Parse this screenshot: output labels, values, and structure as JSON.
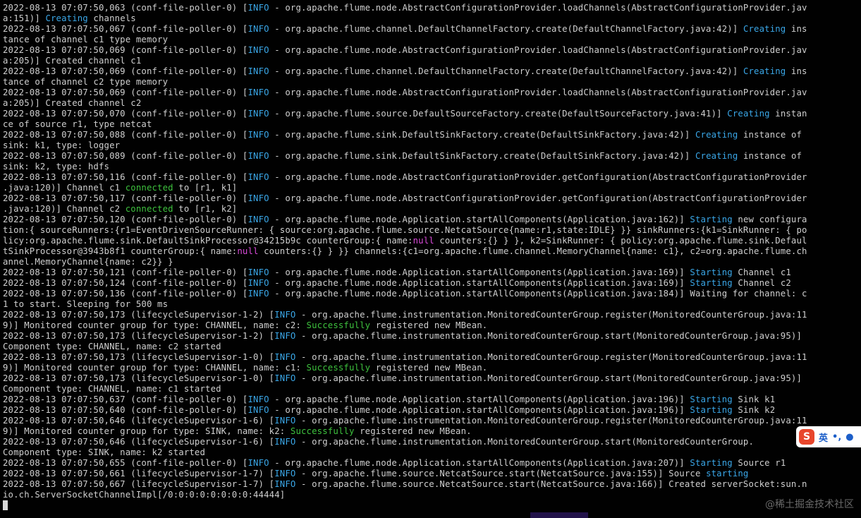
{
  "terminal": {
    "lines": [
      [
        {
          "t": "2022-08-13 07:07:50,063 (conf-file-poller-0) ["
        },
        {
          "t": "INFO",
          "c": "blue"
        },
        {
          "t": " - org.apache.flume.node.AbstractConfigurationProvider.loadChannels(AbstractConfigurationProvider.jav"
        }
      ],
      [
        {
          "t": "a:151)] "
        },
        {
          "t": "Creating",
          "c": "blue"
        },
        {
          "t": " channels"
        }
      ],
      [
        {
          "t": "2022-08-13 07:07:50,067 (conf-file-poller-0) ["
        },
        {
          "t": "INFO",
          "c": "blue"
        },
        {
          "t": " - org.apache.flume.channel.DefaultChannelFactory.create(DefaultChannelFactory.java:42)] "
        },
        {
          "t": "Creating",
          "c": "blue"
        },
        {
          "t": " ins"
        }
      ],
      [
        {
          "t": "tance of channel c1 type memory"
        }
      ],
      [
        {
          "t": "2022-08-13 07:07:50,069 (conf-file-poller-0) ["
        },
        {
          "t": "INFO",
          "c": "blue"
        },
        {
          "t": " - org.apache.flume.node.AbstractConfigurationProvider.loadChannels(AbstractConfigurationProvider.jav"
        }
      ],
      [
        {
          "t": "a:205)] Created channel c1"
        }
      ],
      [
        {
          "t": "2022-08-13 07:07:50,069 (conf-file-poller-0) ["
        },
        {
          "t": "INFO",
          "c": "blue"
        },
        {
          "t": " - org.apache.flume.channel.DefaultChannelFactory.create(DefaultChannelFactory.java:42)] "
        },
        {
          "t": "Creating",
          "c": "blue"
        },
        {
          "t": " ins"
        }
      ],
      [
        {
          "t": "tance of channel c2 type memory"
        }
      ],
      [
        {
          "t": "2022-08-13 07:07:50,069 (conf-file-poller-0) ["
        },
        {
          "t": "INFO",
          "c": "blue"
        },
        {
          "t": " - org.apache.flume.node.AbstractConfigurationProvider.loadChannels(AbstractConfigurationProvider.jav"
        }
      ],
      [
        {
          "t": "a:205)] Created channel c2"
        }
      ],
      [
        {
          "t": "2022-08-13 07:07:50,070 (conf-file-poller-0) ["
        },
        {
          "t": "INFO",
          "c": "blue"
        },
        {
          "t": " - org.apache.flume.source.DefaultSourceFactory.create(DefaultSourceFactory.java:41)] "
        },
        {
          "t": "Creating",
          "c": "blue"
        },
        {
          "t": " instan"
        }
      ],
      [
        {
          "t": "ce of source r1, type netcat"
        }
      ],
      [
        {
          "t": "2022-08-13 07:07:50,088 (conf-file-poller-0) ["
        },
        {
          "t": "INFO",
          "c": "blue"
        },
        {
          "t": " - org.apache.flume.sink.DefaultSinkFactory.create(DefaultSinkFactory.java:42)] "
        },
        {
          "t": "Creating",
          "c": "blue"
        },
        {
          "t": " instance of"
        }
      ],
      [
        {
          "t": "sink: k1, type: logger"
        }
      ],
      [
        {
          "t": "2022-08-13 07:07:50,089 (conf-file-poller-0) ["
        },
        {
          "t": "INFO",
          "c": "blue"
        },
        {
          "t": " - org.apache.flume.sink.DefaultSinkFactory.create(DefaultSinkFactory.java:42)] "
        },
        {
          "t": "Creating",
          "c": "blue"
        },
        {
          "t": " instance of"
        }
      ],
      [
        {
          "t": "sink: k2, type: hdfs"
        }
      ],
      [
        {
          "t": "2022-08-13 07:07:50,116 (conf-file-poller-0) ["
        },
        {
          "t": "INFO",
          "c": "blue"
        },
        {
          "t": " - org.apache.flume.node.AbstractConfigurationProvider.getConfiguration(AbstractConfigurationProvider"
        }
      ],
      [
        {
          "t": ".java:120)] Channel c1 "
        },
        {
          "t": "connected",
          "c": "green"
        },
        {
          "t": " to [r1, k1]"
        }
      ],
      [
        {
          "t": "2022-08-13 07:07:50,117 (conf-file-poller-0) ["
        },
        {
          "t": "INFO",
          "c": "blue"
        },
        {
          "t": " - org.apache.flume.node.AbstractConfigurationProvider.getConfiguration(AbstractConfigurationProvider"
        }
      ],
      [
        {
          "t": ".java:120)] Channel c2 "
        },
        {
          "t": "connected",
          "c": "green"
        },
        {
          "t": " to [r1, k2]"
        }
      ],
      [
        {
          "t": "2022-08-13 07:07:50,120 (conf-file-poller-0) ["
        },
        {
          "t": "INFO",
          "c": "blue"
        },
        {
          "t": " - org.apache.flume.node.Application.startAllComponents(Application.java:162)] "
        },
        {
          "t": "Starting",
          "c": "blue"
        },
        {
          "t": " new configura"
        }
      ],
      [
        {
          "t": "tion:{ sourceRunners:{r1=EventDrivenSourceRunner: { source:org.apache.flume.source.NetcatSource{name:r1,state:IDLE} }} sinkRunners:{k1=SinkRunner: { po"
        }
      ],
      [
        {
          "t": "licy:org.apache.flume.sink.DefaultSinkProcessor@34215b9c counterGroup:{ name:"
        },
        {
          "t": "null",
          "c": "magenta"
        },
        {
          "t": " counters:{} } }, k2=SinkRunner: { policy:org.apache.flume.sink.Defaul"
        }
      ],
      [
        {
          "t": "tSinkProcessor@3943b8f1 counterGroup:{ name:"
        },
        {
          "t": "null",
          "c": "magenta"
        },
        {
          "t": " counters:{} } }} channels:{c1=org.apache.flume.channel.MemoryChannel{name: c1}, c2=org.apache.flume.ch"
        }
      ],
      [
        {
          "t": "annel.MemoryChannel{name: c2}} }"
        }
      ],
      [
        {
          "t": "2022-08-13 07:07:50,121 (conf-file-poller-0) ["
        },
        {
          "t": "INFO",
          "c": "blue"
        },
        {
          "t": " - org.apache.flume.node.Application.startAllComponents(Application.java:169)] "
        },
        {
          "t": "Starting",
          "c": "blue"
        },
        {
          "t": " Channel c1"
        }
      ],
      [
        {
          "t": "2022-08-13 07:07:50,124 (conf-file-poller-0) ["
        },
        {
          "t": "INFO",
          "c": "blue"
        },
        {
          "t": " - org.apache.flume.node.Application.startAllComponents(Application.java:169)] "
        },
        {
          "t": "Starting",
          "c": "blue"
        },
        {
          "t": " Channel c2"
        }
      ],
      [
        {
          "t": "2022-08-13 07:07:50,136 (conf-file-poller-0) ["
        },
        {
          "t": "INFO",
          "c": "blue"
        },
        {
          "t": " - org.apache.flume.node.Application.startAllComponents(Application.java:184)] Waiting for channel: c"
        }
      ],
      [
        {
          "t": "1 to start. Sleeping for 500 ms"
        }
      ],
      [
        {
          "t": "2022-08-13 07:07:50,173 (lifecycleSupervisor-1-2) ["
        },
        {
          "t": "INFO",
          "c": "blue"
        },
        {
          "t": " - org.apache.flume.instrumentation.MonitoredCounterGroup.register(MonitoredCounterGroup.java:11"
        }
      ],
      [
        {
          "t": "9)] Monitored counter group for type: CHANNEL, name: c2: "
        },
        {
          "t": "Successfully",
          "c": "green"
        },
        {
          "t": " registered new MBean."
        }
      ],
      [
        {
          "t": "2022-08-13 07:07:50,173 (lifecycleSupervisor-1-2) ["
        },
        {
          "t": "INFO",
          "c": "blue"
        },
        {
          "t": " - org.apache.flume.instrumentation.MonitoredCounterGroup.start(MonitoredCounterGroup.java:95)]"
        }
      ],
      [
        {
          "t": "Component type: CHANNEL, name: c2 started"
        }
      ],
      [
        {
          "t": "2022-08-13 07:07:50,173 (lifecycleSupervisor-1-0) ["
        },
        {
          "t": "INFO",
          "c": "blue"
        },
        {
          "t": " - org.apache.flume.instrumentation.MonitoredCounterGroup.register(MonitoredCounterGroup.java:11"
        }
      ],
      [
        {
          "t": "9)] Monitored counter group for type: CHANNEL, name: c1: "
        },
        {
          "t": "Successfully",
          "c": "green"
        },
        {
          "t": " registered new MBean."
        }
      ],
      [
        {
          "t": "2022-08-13 07:07:50,173 (lifecycleSupervisor-1-0) ["
        },
        {
          "t": "INFO",
          "c": "blue"
        },
        {
          "t": " - org.apache.flume.instrumentation.MonitoredCounterGroup.start(MonitoredCounterGroup.java:95)]"
        }
      ],
      [
        {
          "t": "Component type: CHANNEL, name: c1 started"
        }
      ],
      [
        {
          "t": "2022-08-13 07:07:50,637 (conf-file-poller-0) ["
        },
        {
          "t": "INFO",
          "c": "blue"
        },
        {
          "t": " - org.apache.flume.node.Application.startAllComponents(Application.java:196)] "
        },
        {
          "t": "Starting",
          "c": "blue"
        },
        {
          "t": " Sink k1"
        }
      ],
      [
        {
          "t": "2022-08-13 07:07:50,640 (conf-file-poller-0) ["
        },
        {
          "t": "INFO",
          "c": "blue"
        },
        {
          "t": " - org.apache.flume.node.Application.startAllComponents(Application.java:196)] "
        },
        {
          "t": "Starting",
          "c": "blue"
        },
        {
          "t": " Sink k2"
        }
      ],
      [
        {
          "t": "2022-08-13 07:07:50,646 (lifecycleSupervisor-1-6) ["
        },
        {
          "t": "INFO",
          "c": "blue"
        },
        {
          "t": " - org.apache.flume.instrumentation.MonitoredCounterGroup.register(MonitoredCounterGroup.java:11"
        }
      ],
      [
        {
          "t": "9)] Monitored counter group for type: SINK, name: k2: "
        },
        {
          "t": "Successfully",
          "c": "green"
        },
        {
          "t": " registered new MBean."
        }
      ],
      [
        {
          "t": "2022-08-13 07:07:50,646 (lifecycleSupervisor-1-6) ["
        },
        {
          "t": "INFO",
          "c": "blue"
        },
        {
          "t": " - org.apache.flume.instrumentation.MonitoredCounterGroup.start(MonitoredCounterGroup."
        }
      ],
      [
        {
          "t": "Component type: SINK, name: k2 started"
        }
      ],
      [
        {
          "t": "2022-08-13 07:07:50,655 (conf-file-poller-0) ["
        },
        {
          "t": "INFO",
          "c": "blue"
        },
        {
          "t": " - org.apache.flume.node.Application.startAllComponents(Application.java:207)] "
        },
        {
          "t": "Starting",
          "c": "blue"
        },
        {
          "t": " Source r1"
        }
      ],
      [
        {
          "t": "2022-08-13 07:07:50,661 (lifecycleSupervisor-1-7) ["
        },
        {
          "t": "INFO",
          "c": "blue"
        },
        {
          "t": " - org.apache.flume.source.NetcatSource.start(NetcatSource.java:155)] Source "
        },
        {
          "t": "starting",
          "c": "blue"
        }
      ],
      [
        {
          "t": "2022-08-13 07:07:50,667 (lifecycleSupervisor-1-7) ["
        },
        {
          "t": "INFO",
          "c": "blue"
        },
        {
          "t": " - org.apache.flume.source.NetcatSource.start(NetcatSource.java:166)] Created serverSocket:sun.n"
        }
      ],
      [
        {
          "t": "io.ch.ServerSocketChannelImpl[/0:0:0:0:0:0:0:0:44444]"
        }
      ]
    ]
  },
  "ime": {
    "logo": "S",
    "mode_label": "英",
    "punct": "•,",
    "mic_icon": "mic-icon"
  },
  "watermark": "@稀土掘金技术社区",
  "colors": {
    "background": "#010101",
    "text": "#cfcfcf",
    "highlight_blue": "#3aa7e8",
    "highlight_green": "#3ec23e",
    "highlight_magenta": "#d94ad9"
  }
}
